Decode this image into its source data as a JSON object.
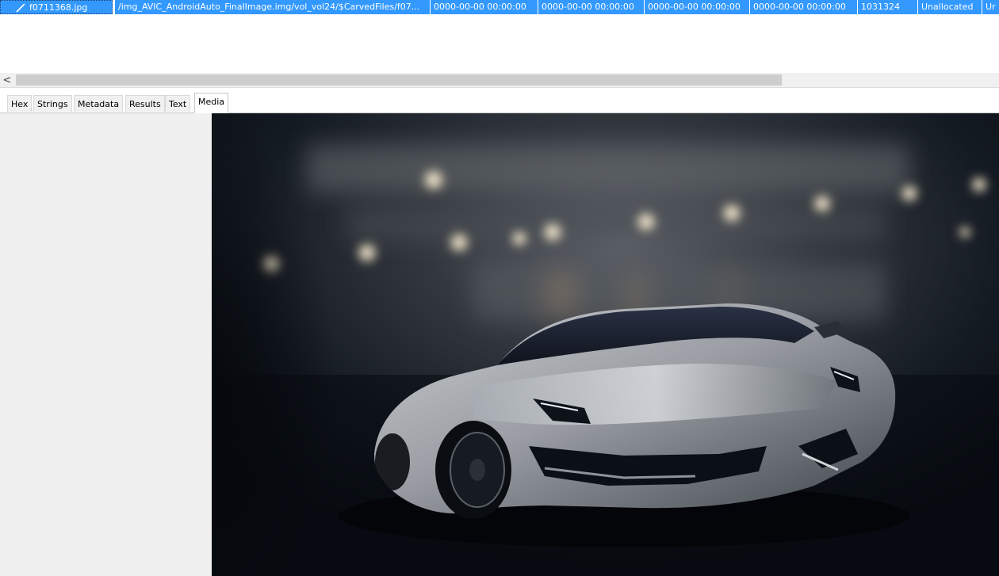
{
  "result_row": {
    "file_name": "f0711368.jpg",
    "path": "/img_AVIC_AndroidAuto_FinalImage.img/vol_vol24/$CarvedFiles/f07...",
    "modified": "0000-00-00 00:00:00",
    "changed": "0000-00-00 00:00:00",
    "accessed": "0000-00-00 00:00:00",
    "created": "0000-00-00 00:00:00",
    "size": "1031324",
    "flags_dir": "Unallocated",
    "flags_meta": "Ur",
    "selected_color": "#3399ff"
  },
  "scrollbar": {
    "left_arrow": "<"
  },
  "tabs": [
    {
      "label": "Hex"
    },
    {
      "label": "Strings"
    },
    {
      "label": "Metadata"
    },
    {
      "label": "Results"
    },
    {
      "label": "Text"
    },
    {
      "label": "Media",
      "active": true
    }
  ],
  "media": {
    "content": "photo of a silver sports car in a dark garage with bokeh lights",
    "icon": "pencil-icon"
  }
}
